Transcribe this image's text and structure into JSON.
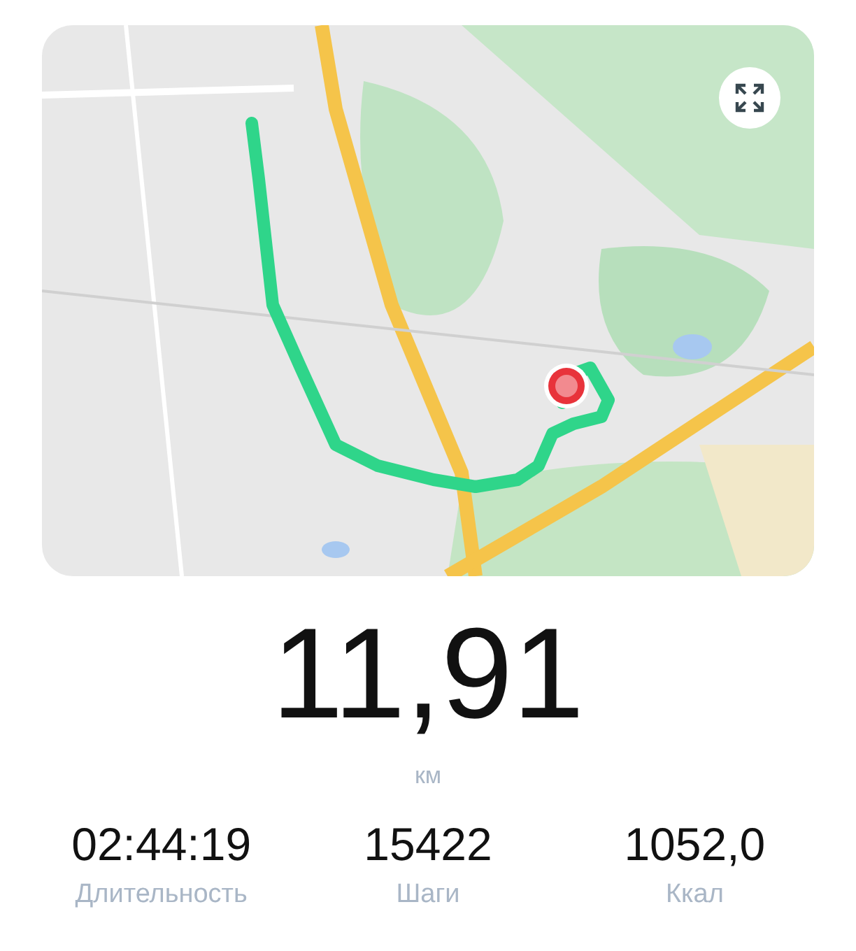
{
  "distance": {
    "value": "11,91",
    "unit": "км"
  },
  "stats": [
    {
      "value": "02:44:19",
      "label": "Длительность"
    },
    {
      "value": "15422",
      "label": "Шаги"
    },
    {
      "value": "1052,0",
      "label": "Ккал"
    }
  ]
}
